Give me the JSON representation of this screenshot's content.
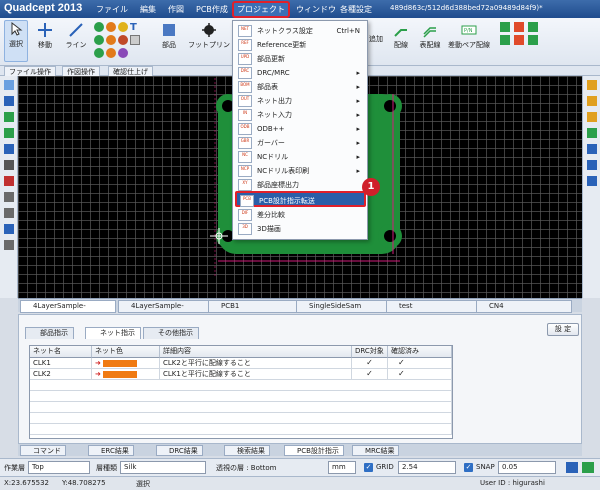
{
  "window": {
    "app_title": "Quadcept 2013",
    "title_text": "489d863c/512d6d388bed72a09489d84f9)*"
  },
  "menubar": {
    "items": [
      "ファイル",
      "編集",
      "作図",
      "PCB作成",
      "プロジェクト",
      "ウィンドウ",
      "各種設定"
    ]
  },
  "ribbon": {
    "select": "選択",
    "move": "移動",
    "line": "ライン",
    "part": "部品",
    "footprint": "フットプリン",
    "add": "追加",
    "wiring": "配線",
    "table_wiring": "表配線",
    "diff_pair": "差動ペア配線",
    "tabs": [
      "ファイル操作",
      "作図操作",
      "確認仕上げ"
    ]
  },
  "dropdown": {
    "items": [
      {
        "label": "ネットクラス設定",
        "shortcut": "Ctrl+N",
        "icon": "netclass-icon"
      },
      {
        "label": "Reference更新",
        "icon": "reference-icon"
      },
      {
        "label": "部品更新",
        "icon": "part-update-icon"
      },
      {
        "label": "DRC/MRC",
        "arrow": "▸",
        "icon": "drc-icon"
      },
      {
        "label": "部品表",
        "arrow": "▸",
        "icon": "bom-icon"
      },
      {
        "label": "ネット出力",
        "arrow": "▸",
        "icon": "net-out-icon"
      },
      {
        "label": "ネット入力",
        "arrow": "▸",
        "icon": "net-in-icon"
      },
      {
        "label": "ODB++",
        "arrow": "▸",
        "icon": "odb-icon"
      },
      {
        "label": "ガーバー",
        "arrow": "▸",
        "icon": "gerber-icon"
      },
      {
        "label": "NCドリル",
        "arrow": "▸",
        "icon": "nc-drill-icon"
      },
      {
        "label": "NCドリル表印刷",
        "arrow": "▸",
        "icon": "nc-print-icon"
      },
      {
        "label": "部品座標出力",
        "icon": "coord-icon"
      },
      {
        "label": "PCB設計指示転送",
        "icon": "pcb-instruction-icon"
      },
      {
        "label": "差分比較",
        "icon": "diff-icon"
      },
      {
        "label": "3D描画",
        "icon": "3d-icon"
      }
    ],
    "callout": "1"
  },
  "doc_tabs": [
    "4LayerSample-",
    "4LayerSample-",
    "PCB1",
    "SingleSideSam",
    "test",
    "CN4"
  ],
  "panel": {
    "tabs": [
      "部品指示",
      "ネット指示",
      "その他指示"
    ],
    "settings": "設 定",
    "columns": [
      "ネット名",
      "ネット色",
      "詳細内容",
      "DRC対象",
      "確認済み"
    ],
    "rows": [
      {
        "net": "CLK1",
        "detail": "CLK2と平行に配線すること",
        "drc": "✓",
        "done": "✓"
      },
      {
        "net": "CLK2",
        "detail": "CLK1と平行に配線すること",
        "drc": "✓",
        "done": "✓"
      }
    ],
    "swatch_color": "#f07a12"
  },
  "bottom_tabs": [
    "コマンド",
    "ERC結果",
    "DRC結果",
    "検索結果",
    "PCB設計指示",
    "MRC結果"
  ],
  "layerbar": {
    "work_layer_label": "作業層",
    "work_layer": "Top",
    "layer_type_label": "層種類",
    "layer_type": "Silk",
    "view_from_label": "透視の層 : Bottom",
    "unit": "mm",
    "grid_label": "GRID",
    "grid_value": "2.54",
    "snap_label": "SNAP",
    "snap_value": "0.05"
  },
  "status": {
    "x": "X:23.675532",
    "y": "Y:48.708275",
    "mode": "選択",
    "user": "User ID : higurashi"
  }
}
